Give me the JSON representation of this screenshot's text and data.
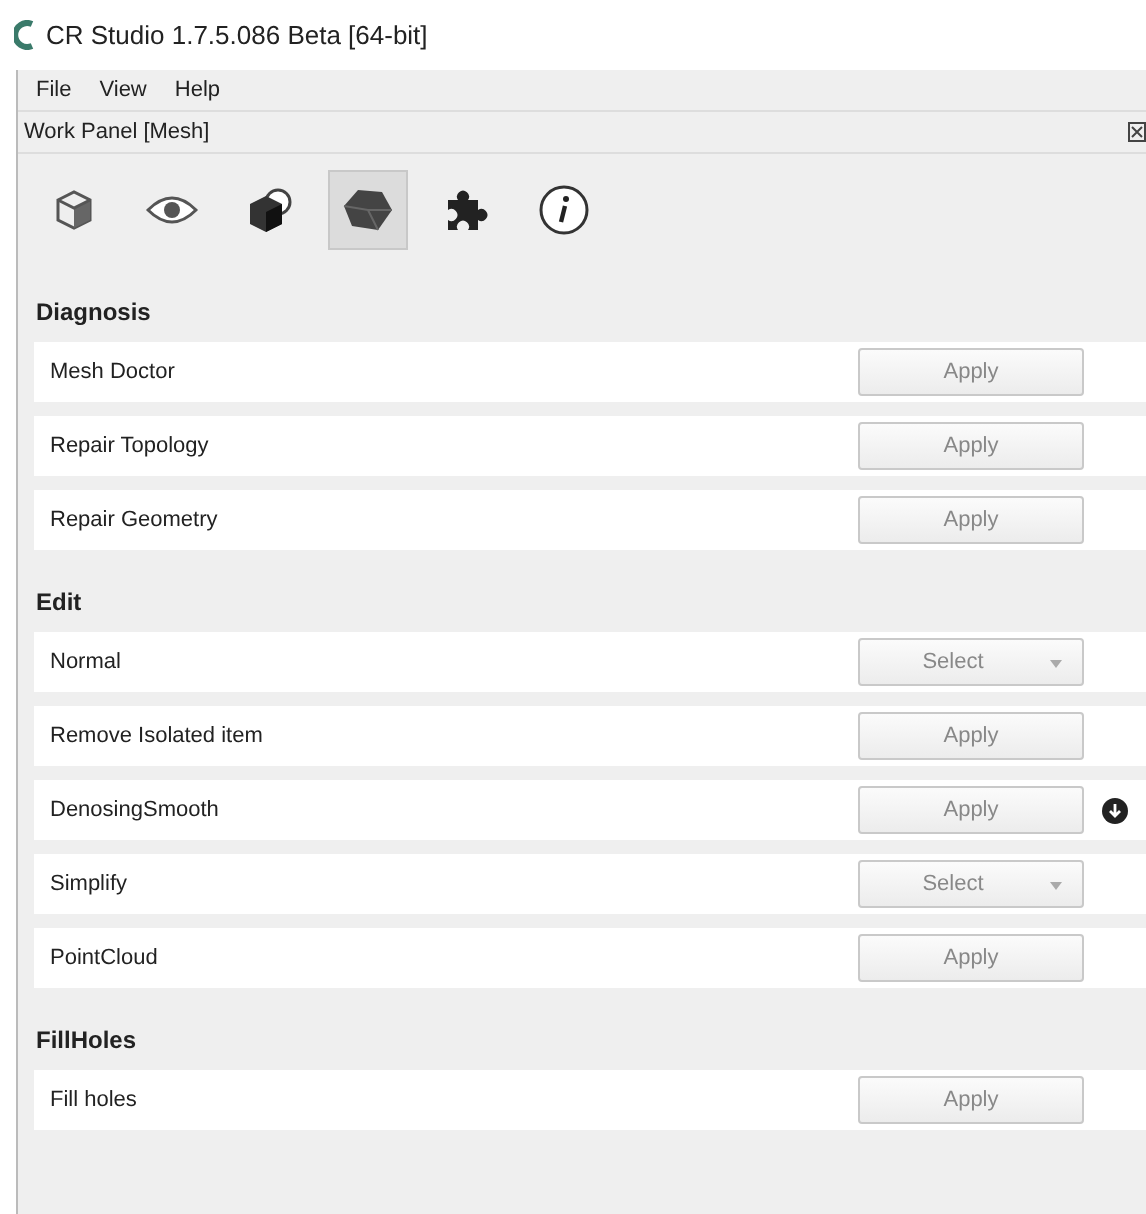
{
  "window": {
    "title": "CR Studio 1.7.5.086 Beta [64-bit]"
  },
  "menu": [
    "File",
    "View",
    "Help"
  ],
  "panel": {
    "title": "Work Panel [Mesh]"
  },
  "tabs": [
    {
      "kind": "cube",
      "selected": false
    },
    {
      "kind": "eye",
      "selected": false
    },
    {
      "kind": "cubesphere",
      "selected": false
    },
    {
      "kind": "mesh",
      "selected": true
    },
    {
      "kind": "puzzle",
      "selected": false
    },
    {
      "kind": "info",
      "selected": false
    }
  ],
  "sections": [
    {
      "title": "Diagnosis",
      "items": [
        {
          "label": "Mesh Doctor",
          "kind": "apply",
          "control": "Apply",
          "download": false
        },
        {
          "label": "Repair Topology",
          "kind": "apply",
          "control": "Apply",
          "download": false
        },
        {
          "label": "Repair Geometry",
          "kind": "apply",
          "control": "Apply",
          "download": false
        }
      ]
    },
    {
      "title": "Edit",
      "items": [
        {
          "label": "Normal",
          "kind": "select",
          "control": "Select",
          "download": false
        },
        {
          "label": "Remove Isolated item",
          "kind": "apply",
          "control": "Apply",
          "download": false
        },
        {
          "label": "DenosingSmooth",
          "kind": "apply",
          "control": "Apply",
          "download": true
        },
        {
          "label": "Simplify",
          "kind": "select",
          "control": "Select",
          "download": false
        },
        {
          "label": "PointCloud",
          "kind": "apply",
          "control": "Apply",
          "download": false
        }
      ]
    },
    {
      "title": "FillHoles",
      "items": [
        {
          "label": "Fill holes",
          "kind": "apply",
          "control": "Apply",
          "download": false
        }
      ]
    }
  ]
}
